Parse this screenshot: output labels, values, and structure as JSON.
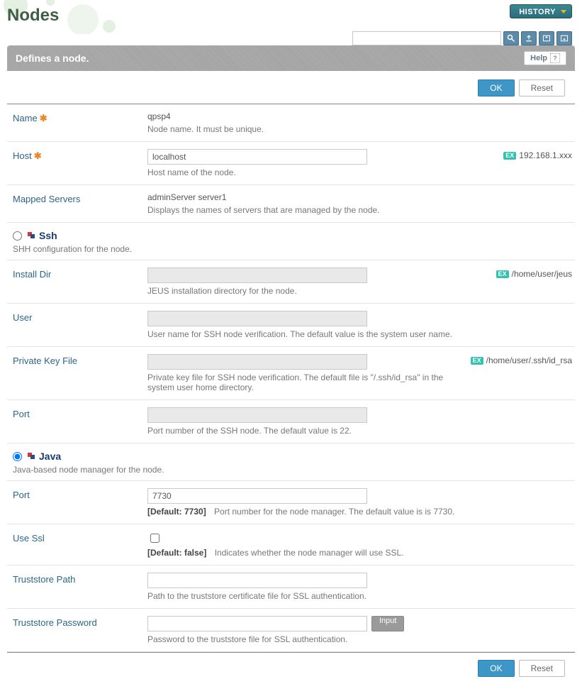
{
  "header": {
    "page_title": "Nodes",
    "history_label": "HISTORY",
    "search_placeholder": ""
  },
  "bar": {
    "title": "Defines a node.",
    "help_label": "Help"
  },
  "actions": {
    "ok_label": "OK",
    "reset_label": "Reset"
  },
  "fields": {
    "name": {
      "label": "Name",
      "value": "qpsp4",
      "desc": "Node name. It must be unique."
    },
    "host": {
      "label": "Host",
      "value": "localhost",
      "desc": "Host name of the node.",
      "ex": "EX",
      "hint": "192.168.1.xxx"
    },
    "mapped": {
      "label": "Mapped Servers",
      "value": "adminServer server1",
      "desc": "Displays the names of servers that are managed by the node."
    }
  },
  "ssh": {
    "title": "Ssh",
    "desc": "SHH configuration for the node.",
    "install_dir": {
      "label": "Install Dir",
      "desc": "JEUS installation directory for the node.",
      "ex": "EX",
      "hint": "/home/user/jeus"
    },
    "user": {
      "label": "User",
      "desc": "User name for SSH node verification. The default value is the system user name."
    },
    "pkey": {
      "label": "Private Key File",
      "desc": "Private key file for SSH node verification. The default file is \"/.ssh/id_rsa\" in the system user home directory.",
      "ex": "EX",
      "hint": "/home/user/.ssh/id_rsa"
    },
    "port": {
      "label": "Port",
      "desc": "Port number of the SSH node. The default value is 22."
    }
  },
  "java": {
    "title": "Java",
    "desc": "Java-based node manager for the node.",
    "port": {
      "label": "Port",
      "value": "7730",
      "default": "[Default: 7730]",
      "desc": "Port number for the node manager. The default value is is 7730."
    },
    "usessl": {
      "label": "Use Ssl",
      "default": "[Default: false]",
      "desc": "Indicates whether the node manager will use SSL."
    },
    "tspath": {
      "label": "Truststore Path",
      "desc": "Path to the truststore certificate file for SSL authentication."
    },
    "tspwd": {
      "label": "Truststore Password",
      "desc": "Password to the truststore file for SSL authentication.",
      "input_btn": "Input"
    }
  }
}
